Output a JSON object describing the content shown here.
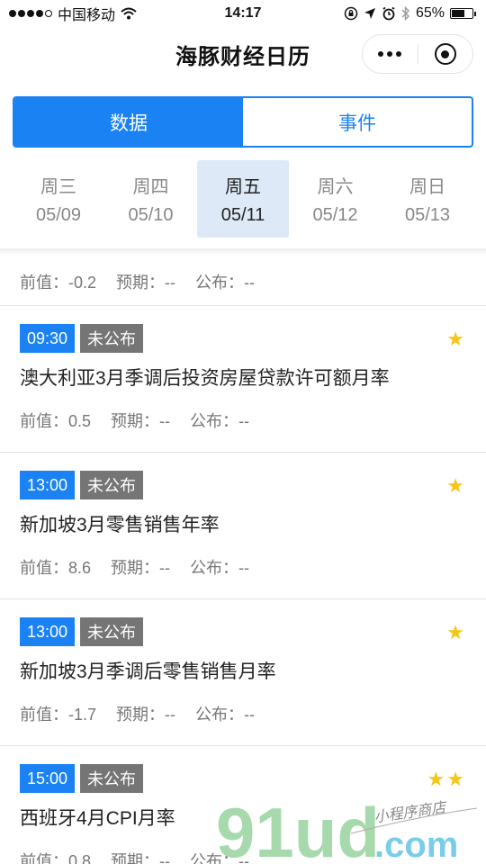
{
  "status_bar": {
    "carrier": "中国移动",
    "time": "14:17",
    "battery": "65%",
    "battery_level": 0.65
  },
  "nav": {
    "title": "海豚财经日历"
  },
  "segments": [
    {
      "label": "数据",
      "active": true
    },
    {
      "label": "事件",
      "active": false
    }
  ],
  "days": [
    {
      "weekday": "周三",
      "date": "05/09"
    },
    {
      "weekday": "周四",
      "date": "05/10"
    },
    {
      "weekday": "周五",
      "date": "05/11",
      "active": true
    },
    {
      "weekday": "周六",
      "date": "05/12"
    },
    {
      "weekday": "周日",
      "date": "05/13"
    }
  ],
  "first_meta": {
    "prev": "前值：-0.2",
    "expected": "预期：--",
    "actual": "公布：--"
  },
  "items": [
    {
      "time": "09:30",
      "status": "未公布",
      "stars": "★",
      "title": "澳大利亚3月季调后投资房屋贷款许可额月率",
      "prev": "前值：0.5",
      "expected": "预期：--",
      "actual": "公布：--"
    },
    {
      "time": "13:00",
      "status": "未公布",
      "stars": "★",
      "title": "新加坡3月零售销售年率",
      "prev": "前值：8.6",
      "expected": "预期：--",
      "actual": "公布：--"
    },
    {
      "time": "13:00",
      "status": "未公布",
      "stars": "★",
      "title": "新加坡3月季调后零售销售月率",
      "prev": "前值：-1.7",
      "expected": "预期：--",
      "actual": "公布：--"
    },
    {
      "time": "15:00",
      "status": "未公布",
      "stars": "★★",
      "title": "西班牙4月CPI月率",
      "prev": "前值：0.8",
      "expected": "预期：--",
      "actual": "公布：--"
    }
  ],
  "watermark": {
    "logo": "91ud",
    "domain": ".com",
    "slogan": "小程序商店"
  },
  "colors": {
    "accent": "#1a82f2",
    "status_tag": "#757575",
    "star": "#f5c518",
    "selected_day": "#dde9f7"
  }
}
